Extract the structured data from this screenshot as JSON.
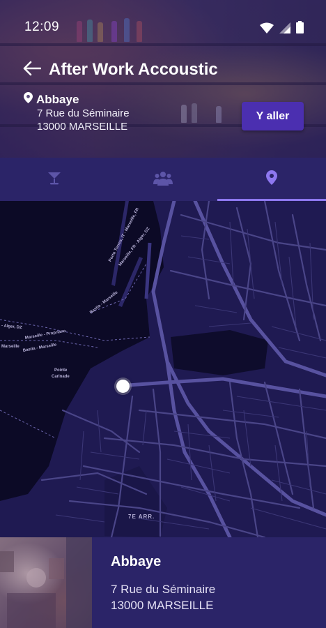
{
  "status_bar": {
    "time": "12:09"
  },
  "header": {
    "title": "After Work Accoustic",
    "venue_name": "Abbaye",
    "address_line1": "7 Rue du Séminaire",
    "address_line2": "13000 MARSEILLE",
    "go_button": "Y aller"
  },
  "tabs": [
    {
      "icon": "cocktail-icon",
      "active": false
    },
    {
      "icon": "group-icon",
      "active": false
    },
    {
      "icon": "location-pin-icon",
      "active": true
    }
  ],
  "map": {
    "labels": [
      "Porto Torres, IT - Marseille, FR",
      "Marseille, FR - Alger, DZ",
      "Bastia - Marseille",
      "- Alger, DZ",
      "Marseille - Propriano",
      "Bastia - Marseille",
      "Marseille",
      "Pointe",
      "Carinade",
      "7E ARR."
    ]
  },
  "card": {
    "title": "Abbaye",
    "address_line1": "7 Rue du Séminaire",
    "address_line2": "13000 MARSEILLE"
  },
  "colors": {
    "accent": "#8e78f0",
    "button": "#4b2fb0",
    "tab_bar": "#2b2468",
    "map_bg": "#0c0a26",
    "map_road": "#4a4588"
  }
}
